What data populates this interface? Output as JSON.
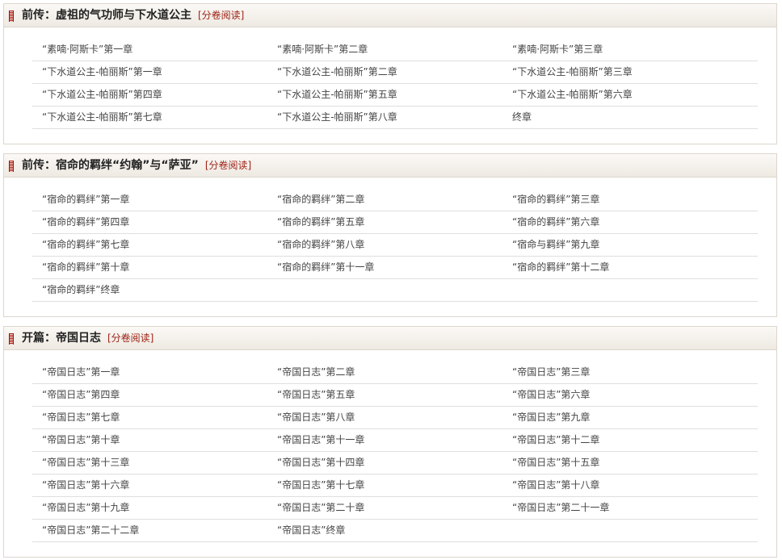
{
  "volumes": [
    {
      "title": "前传：虚祖的气功师与下水道公主",
      "link": "[分卷阅读]",
      "chapters": [
        "“素喃·阿斯卡”第一章",
        "“素喃·阿斯卡”第二章",
        "“素喃·阿斯卡”第三章",
        "“下水道公主-帕丽斯”第一章",
        "“下水道公主-帕丽斯”第二章",
        "“下水道公主-帕丽斯”第三章",
        "“下水道公主-帕丽斯”第四章",
        "“下水道公主-帕丽斯”第五章",
        "“下水道公主-帕丽斯”第六章",
        "“下水道公主-帕丽斯”第七章",
        "“下水道公主-帕丽斯”第八章",
        "终章"
      ]
    },
    {
      "title": "前传：宿命的羁绊“约翰”与“萨亚”",
      "link": "[分卷阅读]",
      "chapters": [
        "“宿命的羁绊”第一章",
        "“宿命的羁绊”第二章",
        "“宿命的羁绊”第三章",
        "“宿命的羁绊”第四章",
        "“宿命的羁绊”第五章",
        "“宿命的羁绊”第六章",
        "“宿命的羁绊”第七章",
        "“宿命的羁绊”第八章",
        "“宿命与羁绊”第九章",
        "“宿命的羁绊”第十章",
        "“宿命的羁绊”第十一章",
        "“宿命的羁绊”第十二章",
        "“宿命的羁绊”终章"
      ]
    },
    {
      "title": "开篇：帝国日志",
      "link": "[分卷阅读]",
      "chapters": [
        "“帝国日志”第一章",
        "“帝国日志”第二章",
        "“帝国日志”第三章",
        "“帝国日志”第四章",
        "“帝国日志”第五章",
        "“帝国日志”第六章",
        "“帝国日志”第七章",
        "“帝国日志”第八章",
        "“帝国日志”第九章",
        "“帝国日志”第十章",
        "“帝国日志”第十一章",
        "“帝国日志”第十二章",
        "“帝国日志”第十三章",
        "“帝国日志”第十四章",
        "“帝国日志”第十五章",
        "“帝国日志”第十六章",
        "“帝国日志”第十七章",
        "“帝国日志”第十八章",
        "“帝国日志”第十九章",
        "“帝国日志”第二十章",
        "“帝国日志”第二十一章",
        "“帝国日志”第二十二章",
        "“帝国日志”终章"
      ]
    }
  ]
}
